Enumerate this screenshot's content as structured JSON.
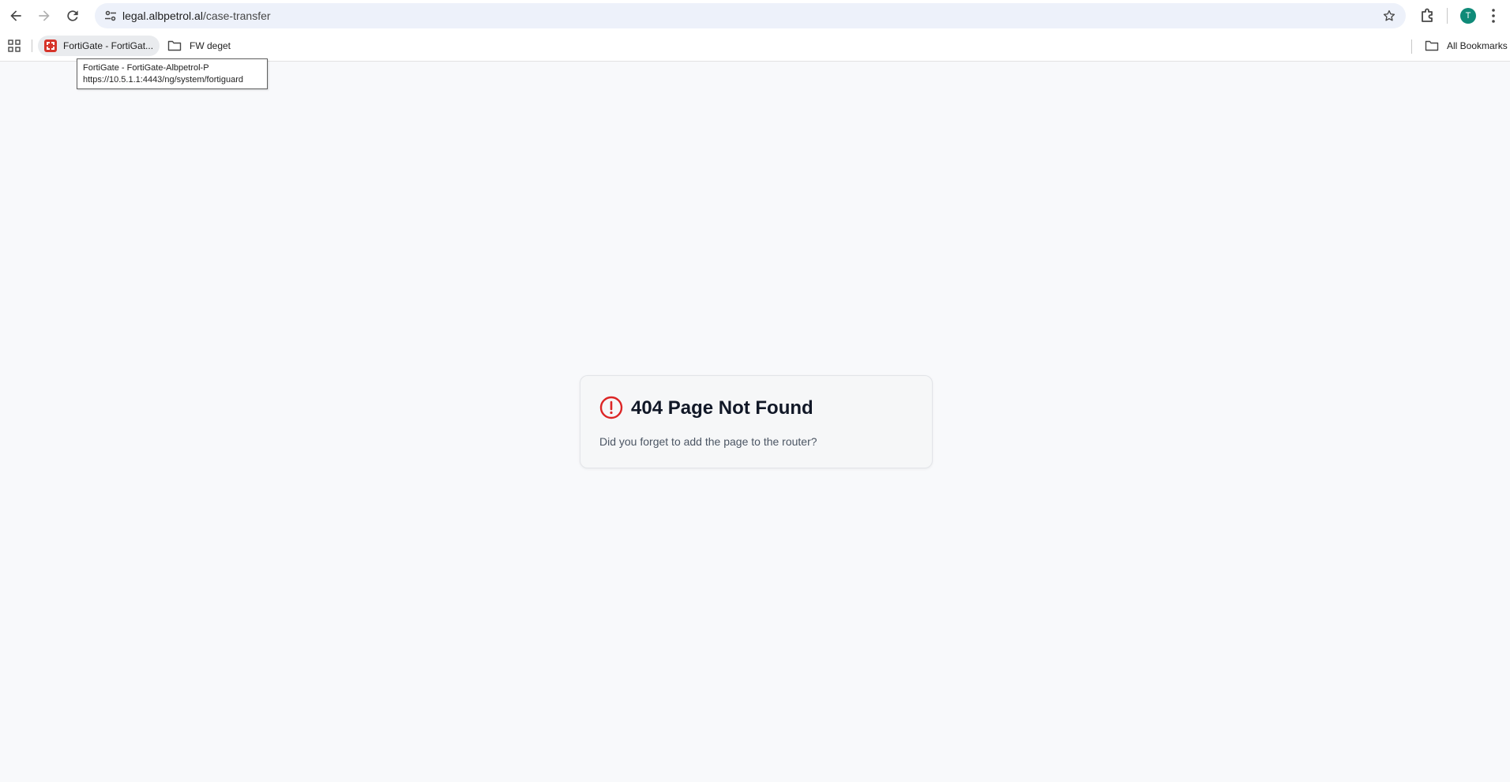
{
  "browser": {
    "url_host": "legal.albpetrol.al",
    "url_path": "/case-transfer",
    "avatar_initial": "T",
    "accent_color": "#0f8a78"
  },
  "bookmarks": {
    "items": [
      {
        "label": "FortiGate - FortiGat...",
        "icon": "fortigate-favicon"
      },
      {
        "label": "FW deget",
        "icon": "folder-icon"
      }
    ],
    "all_bookmarks_label": "All Bookmarks"
  },
  "tooltip": {
    "title": "FortiGate - FortiGate-Albpetrol-P",
    "url": "https://10.5.1.1:4443/ng/system/fortiguard"
  },
  "error": {
    "title": "404 Page Not Found",
    "message": "Did you forget to add the page to the router?",
    "icon": "alert-circle-icon",
    "icon_color": "#dc2626"
  }
}
